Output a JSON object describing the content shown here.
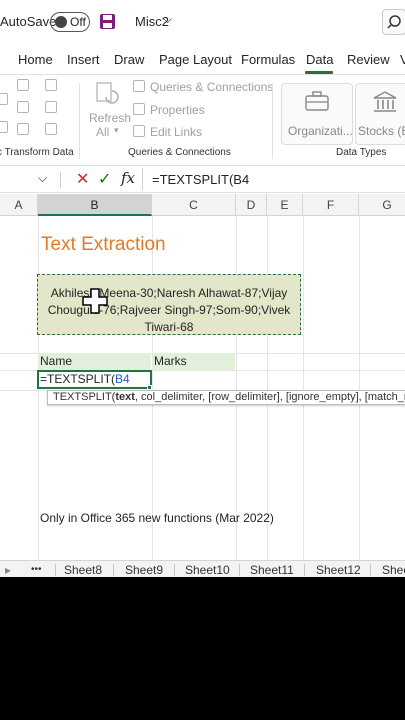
{
  "titlebar": {
    "autosave_label": "AutoSave",
    "autosave_state": "Off",
    "file_name": "Misc2",
    "file_chevron": "⌵"
  },
  "tabs": [
    "Home",
    "Insert",
    "Draw",
    "Page Layout",
    "Formulas",
    "Data",
    "Review",
    "V"
  ],
  "active_tab": "Data",
  "ribbon": {
    "queries_connections": "Queries & Connections",
    "properties": "Properties",
    "edit_links": "Edit Links",
    "refresh_label": "Refresh",
    "refresh_all_label": "All",
    "group_transform": "c Transform Data",
    "group_queries": "Queries & Connections",
    "group_datatypes": "Data Types",
    "datatype_org": "Organizati...",
    "datatype_stocks": "Stocks (En"
  },
  "formula_bar": {
    "namebox_chevron": "⌵",
    "cancel": "✕",
    "enter": "✓",
    "fx": "fx",
    "formula": "=TEXTSPLIT(B4"
  },
  "columns": [
    "A",
    "B",
    "C",
    "D",
    "E",
    "F",
    "G"
  ],
  "sheet": {
    "title": "Text Extraction",
    "b4_line1": "Akhilesh Meena-30;Naresh Alhawat-87;Vijay",
    "b4_line2": "Chougule-76;Rajveer Singh-97;Som-90;Vivek",
    "b4_line3": "Tiwari-68",
    "header_name": "Name",
    "header_marks": "Marks",
    "active_prefix": "=TEXTSPLIT(",
    "active_ref": "B4",
    "tooltip_fn": "TEXTSPLIT(",
    "tooltip_arg": "text",
    "tooltip_rest": ", col_delimiter, [row_delimiter], [ignore_empty], [match_mode]",
    "note": "Only in Office 365 new functions (Mar 2022)"
  },
  "sheet_tabs": {
    "more": "•••",
    "tabs": [
      "Sheet8",
      "Sheet9",
      "Sheet10",
      "Sheet11",
      "Sheet12",
      "Shee"
    ]
  },
  "colors": {
    "accent_green": "#217346",
    "title_orange": "#e07b2a",
    "b4_fill": "#e3e6c9",
    "header_fill": "#e2efda"
  }
}
